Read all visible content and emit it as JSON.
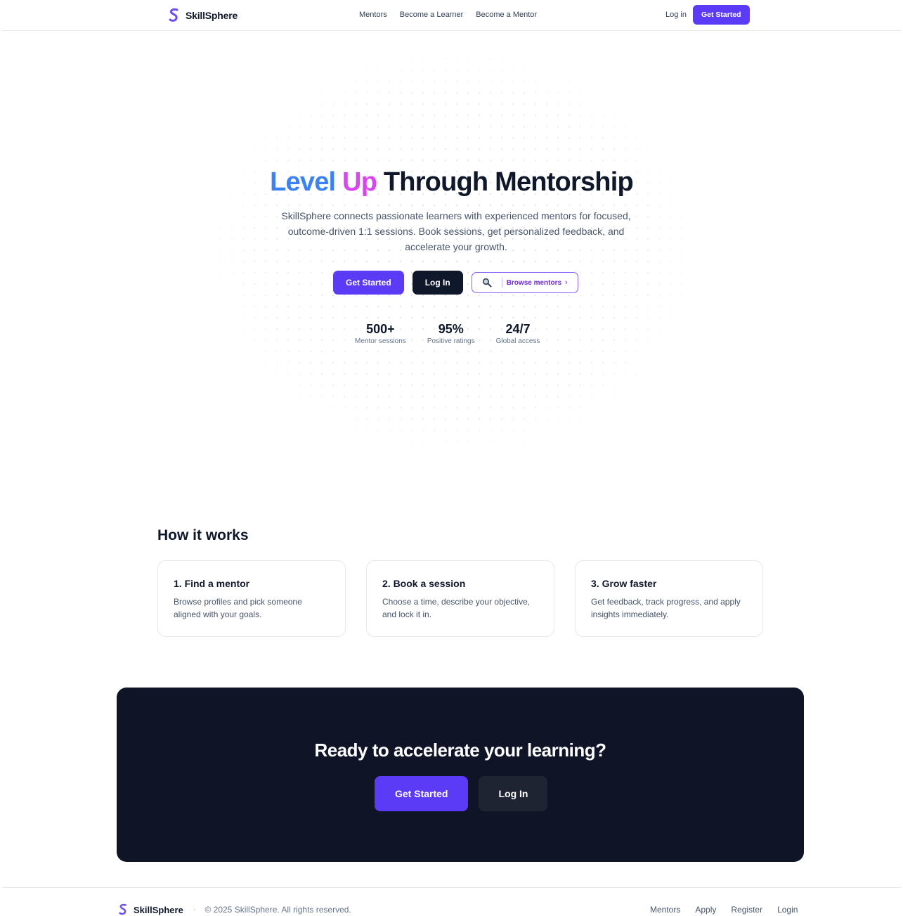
{
  "brand": {
    "name": "SkillSphere",
    "accent": "#5b3bf5"
  },
  "nav": {
    "links": [
      "Mentors",
      "Become a Learner",
      "Become a Mentor"
    ],
    "login_label": "Log in",
    "cta_label": "Get Started"
  },
  "hero": {
    "title_part1": "Level",
    "title_part2": "Up",
    "title_part3": "Through Mentorship",
    "subtitle": "SkillSphere connects passionate learners with experienced mentors for focused, outcome-driven 1:1 sessions. Book sessions, get personalized feedback, and accelerate your growth.",
    "primary_cta": "Get Started",
    "secondary_cta": "Log In",
    "browse_label": "Browse mentors",
    "browse_icon": "search-icon",
    "stats": [
      {
        "value": "500+",
        "label": "Mentor sessions"
      },
      {
        "value": "95%",
        "label": "Positive ratings"
      },
      {
        "value": "24/7",
        "label": "Global access"
      }
    ]
  },
  "how": {
    "title": "How it works",
    "steps": [
      {
        "title": "1. Find a mentor",
        "desc": "Browse profiles and pick someone aligned with your goals."
      },
      {
        "title": "2. Book a session",
        "desc": "Choose a time, describe your objective, and lock it in."
      },
      {
        "title": "3. Grow faster",
        "desc": "Get feedback, track progress, and apply insights immediately."
      }
    ]
  },
  "cta": {
    "title": "Ready to accelerate your learning?",
    "primary": "Get Started",
    "secondary": "Log In"
  },
  "footer": {
    "brand": "SkillSphere",
    "separator": "·",
    "copyright": "© 2025 SkillSphere. All rights reserved.",
    "links": [
      "Mentors",
      "Apply",
      "Register",
      "Login"
    ]
  }
}
